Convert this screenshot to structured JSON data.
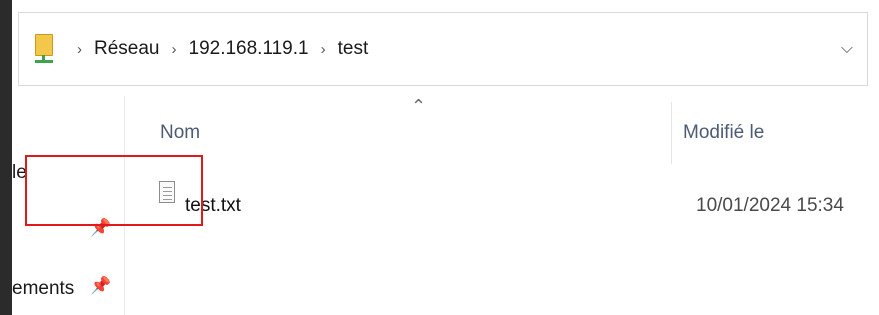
{
  "address_bar": {
    "location_icon": "network-computer-icon",
    "breadcrumbs": [
      "Réseau",
      "192.168.119.1",
      "test"
    ],
    "separator_icon": "chevron-right-icon",
    "dropdown_icon": "chevron-down-icon"
  },
  "nav_pane": {
    "items": [
      {
        "label": "le",
        "pinned": false
      },
      {
        "label": "",
        "pinned": true
      },
      {
        "label": "ements",
        "pinned": true
      }
    ],
    "pin_icon": "pin-icon"
  },
  "file_list": {
    "sort_indicator": "sort-ascending-icon",
    "columns": [
      "Nom",
      "Modifié le"
    ],
    "rows": [
      {
        "name": "test.txt",
        "modified": "10/01/2024 15:34",
        "icon": "text-file-icon",
        "highlighted": true
      }
    ]
  },
  "colors": {
    "highlight_border": "#e0191b",
    "column_header_text": "#4d5b73"
  }
}
